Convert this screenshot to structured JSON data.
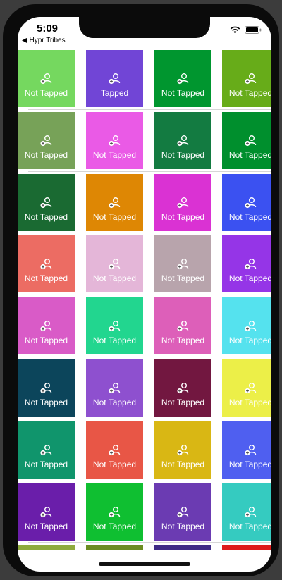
{
  "status_bar": {
    "time": "5:09",
    "back_label": "Hypr Tribes"
  },
  "tile_icon": "add-person-icon",
  "rows": [
    [
      {
        "label": "Not Tapped",
        "color": "#75d85f"
      },
      {
        "label": "Tapped",
        "color": "#7145d6"
      },
      {
        "label": "Not Tapped",
        "color": "#00962f"
      },
      {
        "label": "Not Tapped",
        "color": "#67ac19"
      }
    ],
    [
      {
        "label": "Not Tapped",
        "color": "#77a258"
      },
      {
        "label": "Not Tapped",
        "color": "#ea5ae6"
      },
      {
        "label": "Not Tapped",
        "color": "#137b41"
      },
      {
        "label": "Not Tapped",
        "color": "#008f2d"
      }
    ],
    [
      {
        "label": "Not Tapped",
        "color": "#1a6a32"
      },
      {
        "label": "Not Tapped",
        "color": "#de8704"
      },
      {
        "label": "Not Tapped",
        "color": "#da32d3"
      },
      {
        "label": "Not Tapped",
        "color": "#3b51f1"
      }
    ],
    [
      {
        "label": "Not Tapped",
        "color": "#ec6c63"
      },
      {
        "label": "Not Tapped",
        "color": "#e4b6d8"
      },
      {
        "label": "Not Tapped",
        "color": "#b8a4ac"
      },
      {
        "label": "Not Tapped",
        "color": "#9535e7"
      }
    ],
    [
      {
        "label": "Not Tapped",
        "color": "#d95bc7"
      },
      {
        "label": "Not Tapped",
        "color": "#22d68f"
      },
      {
        "label": "Not Tapped",
        "color": "#dd5fb9"
      },
      {
        "label": "Not Tapped",
        "color": "#55e2ee"
      }
    ],
    [
      {
        "label": "Not Tapped",
        "color": "#0c455b"
      },
      {
        "label": "Not Tapped",
        "color": "#8e50cf"
      },
      {
        "label": "Not Tapped",
        "color": "#721740"
      },
      {
        "label": "Not Tapped",
        "color": "#ecef48"
      }
    ],
    [
      {
        "label": "Not Tapped",
        "color": "#10956c"
      },
      {
        "label": "Not Tapped",
        "color": "#e85646"
      },
      {
        "label": "Not Tapped",
        "color": "#d9b714"
      },
      {
        "label": "Not Tapped",
        "color": "#4f5ff0"
      }
    ],
    [
      {
        "label": "Not Tapped",
        "color": "#6a1eaa"
      },
      {
        "label": "Not Tapped",
        "color": "#0fbf31"
      },
      {
        "label": "Not Tapped",
        "color": "#6b3bb2"
      },
      {
        "label": "Not Tapped",
        "color": "#35cbc0"
      }
    ],
    [
      {
        "label": "",
        "color": "#8eaa3c"
      },
      {
        "label": "",
        "color": "#6b8d21"
      },
      {
        "label": "",
        "color": "#3f2b86"
      },
      {
        "label": "",
        "color": "#de1b1b"
      }
    ]
  ]
}
